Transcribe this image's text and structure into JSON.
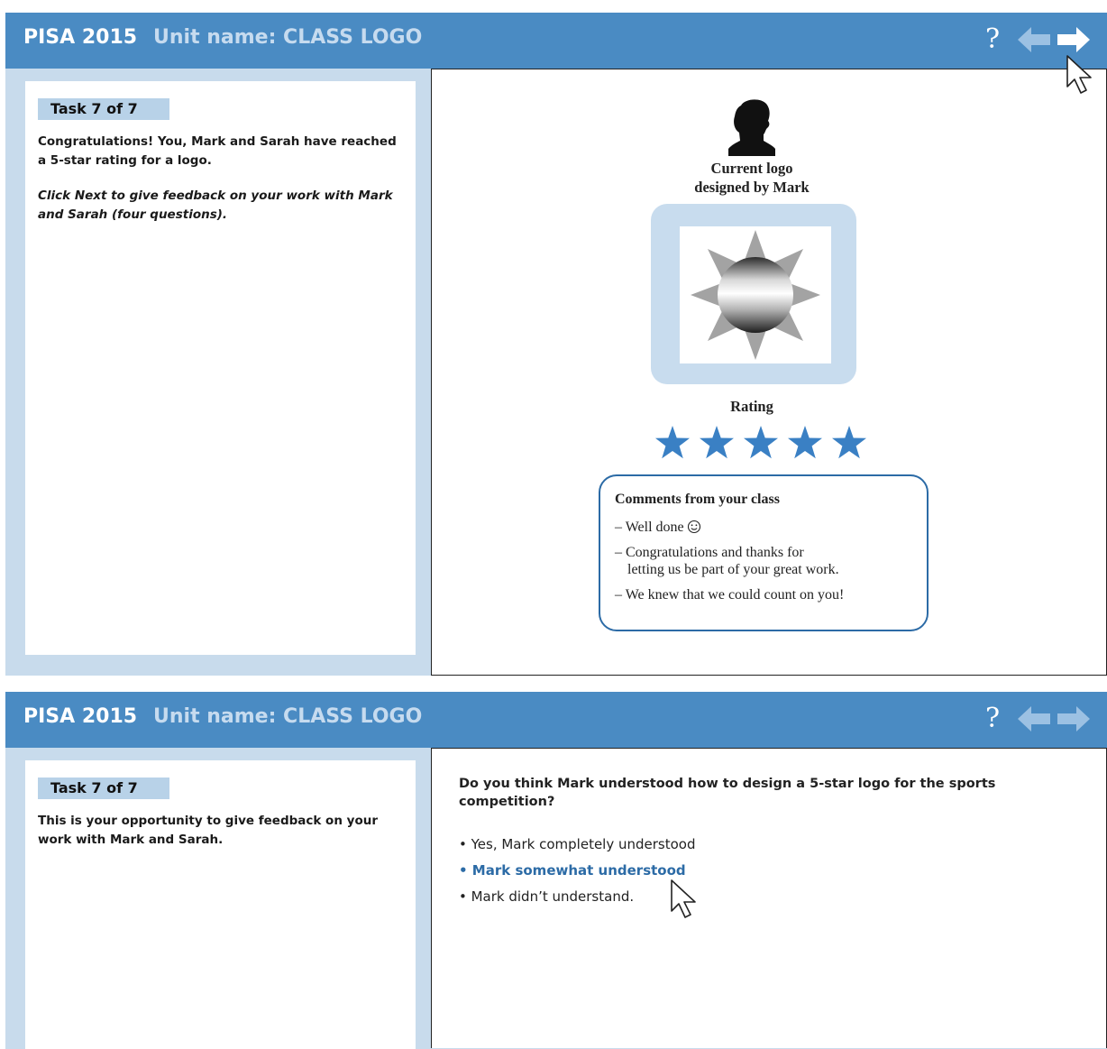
{
  "colors": {
    "header_bg": "#4a8bc3",
    "frame_bg": "#c8dbec",
    "accent_blue": "#2c6ba6",
    "star_blue": "#3a80c4"
  },
  "screen1": {
    "header": {
      "title": "PISA 2015",
      "unit_name": "Unit name: CLASS LOGO",
      "help_label": "?",
      "back_icon": "arrow-left-icon",
      "next_icon": "arrow-right-icon"
    },
    "task": {
      "label": "Task 7 of 7",
      "text": "Congratulations! You, Mark and Sarah have reached a 5-star rating for a logo.",
      "instruction": "Click Next to give feedback on your work with Mark and Sarah (four questions)."
    },
    "logo": {
      "caption_line1": "Current logo",
      "caption_line2": "designed by Mark",
      "avatar_icon": "person-silhouette-icon",
      "image_icon": "sun-logo-icon"
    },
    "rating": {
      "label": "Rating",
      "stars": 5,
      "max_stars": 5
    },
    "comments": {
      "title": "Comments from your class",
      "items": [
        "– Well done",
        "– Congratulations and thanks for",
        "letting us be part of your great work.",
        "– We knew that we could count on you!"
      ]
    }
  },
  "screen2": {
    "header": {
      "title": "PISA 2015",
      "unit_name": "Unit name: CLASS LOGO",
      "help_label": "?",
      "back_icon": "arrow-left-icon",
      "next_icon": "arrow-right-icon"
    },
    "task": {
      "label": "Task 7 of 7",
      "text": "This is your opportunity to give feedback on your work with Mark and Sarah."
    },
    "question": "Do you think Mark understood how to design a 5-star logo for the sports competition?",
    "options": [
      "• Yes, Mark completely understood",
      "• Mark somewhat understood",
      "• Mark didn’t understand."
    ],
    "selected_option": 1
  }
}
